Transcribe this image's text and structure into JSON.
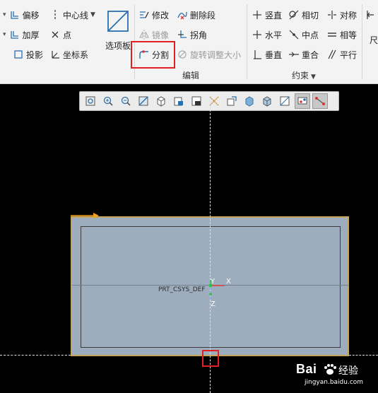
{
  "ribbon": {
    "col1": {
      "offset": "偏移",
      "thicken": "加厚",
      "project": "投影"
    },
    "col2": {
      "centerline": "中心线",
      "point": "点",
      "csys": "坐标系"
    },
    "palette": "选项板",
    "edit": {
      "modify": "修改",
      "mirror": "镜像",
      "divide": "分割",
      "delete_segment": "删除段",
      "corner": "拐角",
      "rotate_resize": "旋转调整大小",
      "group_label": "编辑"
    },
    "constraint": {
      "vertical": "竖直",
      "horizontal": "水平",
      "perpendicular": "垂直",
      "tangent": "相切",
      "midpoint": "中点",
      "coincident": "重合",
      "symmetric": "对称",
      "equal": "相等",
      "parallel": "平行",
      "group_label": "约束"
    },
    "dimension": "尺"
  },
  "canvas": {
    "csys_name": "PRT_CSYS_DEF",
    "axis_x": "X",
    "axis_y": "Y",
    "axis_z": "Z"
  },
  "toolbar_icons": [
    "zoom-fit-icon",
    "zoom-in-icon",
    "zoom-out-icon",
    "repaint-icon",
    "orientation-icon",
    "saved-views-icon",
    "display-style-icon",
    "datum-display-icon",
    "annotation-icon",
    "shade-icon",
    "shade-edges-icon",
    "sketch-view-icon",
    "sketch-display-icon",
    "constraint-display-icon"
  ],
  "watermark": {
    "brand": "Bai",
    "text": "经验",
    "url": "jingyan.baidu.com"
  },
  "colors": {
    "highlight": "#e02020",
    "sketch_fill": "#9eadbd",
    "sketch_edge": "#c7a45c"
  }
}
